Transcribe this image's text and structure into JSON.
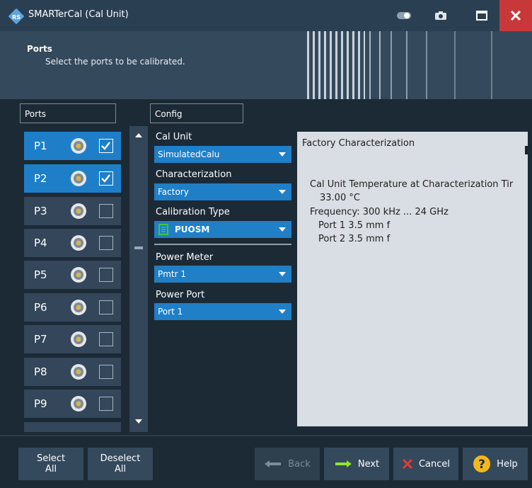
{
  "window": {
    "title": "SMARTerCal (Cal Unit)"
  },
  "header": {
    "title": "Ports",
    "subtitle": "Select the ports to be calibrated."
  },
  "ports_panel": {
    "heading": "Ports",
    "ports": [
      {
        "label": "P1",
        "checked": true
      },
      {
        "label": "P2",
        "checked": true
      },
      {
        "label": "P3",
        "checked": false
      },
      {
        "label": "P4",
        "checked": false
      },
      {
        "label": "P5",
        "checked": false
      },
      {
        "label": "P6",
        "checked": false
      },
      {
        "label": "P7",
        "checked": false
      },
      {
        "label": "P8",
        "checked": false
      },
      {
        "label": "P9",
        "checked": false
      }
    ]
  },
  "config": {
    "heading": "Config",
    "cal_unit": {
      "label": "Cal Unit",
      "value": "SimulatedCalu"
    },
    "characterization": {
      "label": "Characterization",
      "value": "Factory"
    },
    "calibration_type": {
      "label": "Calibration Type",
      "value": "PUOSM"
    },
    "power_meter": {
      "label": "Power Meter",
      "value": "Pmtr 1"
    },
    "power_port": {
      "label": "Power Port",
      "value": "Port 1"
    }
  },
  "info": {
    "title": "Factory Characterization",
    "line1": "Cal Unit Temperature at Characterization Tir",
    "line2": "33.00 °C",
    "line3": "Frequency: 300 kHz ... 24 GHz",
    "line4": "Port 1 3.5 mm f",
    "line5": "Port 2 3.5 mm f"
  },
  "footer": {
    "select_all": [
      "Select",
      "All"
    ],
    "deselect_all": [
      "Deselect",
      "All"
    ],
    "back": "Back",
    "next": "Next",
    "cancel": "Cancel",
    "help": "Help"
  },
  "colors": {
    "accent": "#1e7fc8",
    "background": "#1c2a36",
    "close": "#c83838",
    "next_arrow": "#8ee62a",
    "cancel_x": "#e23a3a",
    "help": "#f2b81d"
  },
  "icons": [
    "app-logo-icon",
    "toggle-icon",
    "camera-icon",
    "maximize-icon",
    "close-icon",
    "connector-icon",
    "checkbox-check-icon",
    "scroll-up-icon",
    "scroll-down-icon",
    "left-arrow-icon",
    "right-arrow-icon",
    "x-icon",
    "question-icon",
    "calibration-type-icon"
  ]
}
